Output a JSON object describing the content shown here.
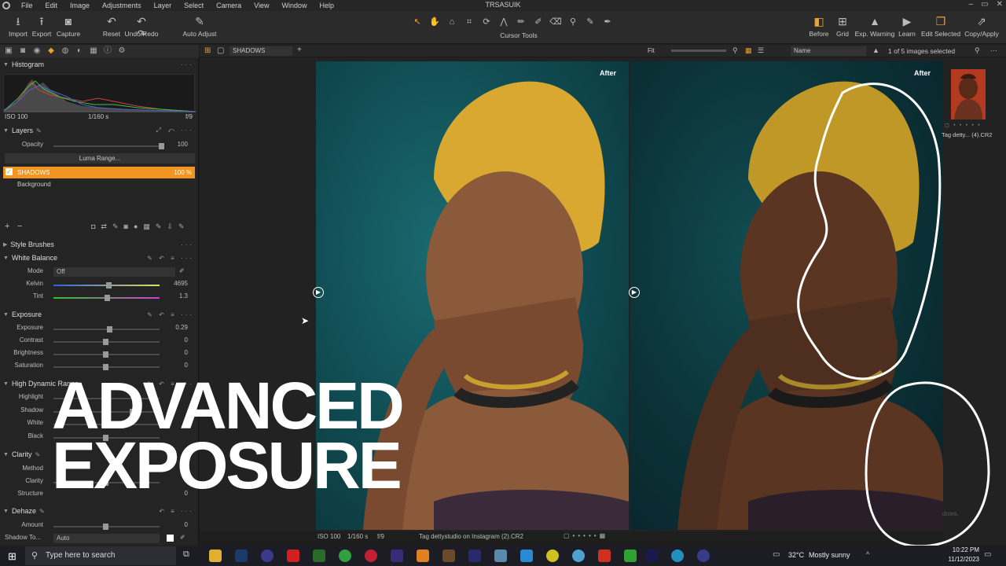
{
  "window": {
    "title": "TRSASUIK"
  },
  "menu": [
    "File",
    "Edit",
    "Image",
    "Adjustments",
    "Layer",
    "Select",
    "Camera",
    "View",
    "Window",
    "Help"
  ],
  "toolbar": {
    "left": [
      {
        "label": "Import",
        "icon": "import-icon"
      },
      {
        "label": "Export",
        "icon": "export-icon"
      },
      {
        "label": "Capture",
        "icon": "camera-icon"
      },
      {
        "label": "Reset",
        "icon": "reset-icon"
      },
      {
        "label": "Undo/Redo",
        "icon": "undo-redo-icon"
      },
      {
        "label": "Auto Adjust",
        "icon": "wand-icon"
      }
    ],
    "cursor_tools_label": "Cursor Tools",
    "right": [
      {
        "label": "Before",
        "icon": "before-icon"
      },
      {
        "label": "Grid",
        "icon": "grid-icon"
      },
      {
        "label": "Exp. Warning",
        "icon": "warning-icon"
      },
      {
        "label": "Learn",
        "icon": "play-icon"
      },
      {
        "label": "Edit Selected",
        "icon": "edit-selected-icon"
      },
      {
        "label": "Copy/Apply",
        "icon": "copy-apply-icon"
      }
    ]
  },
  "histogram": {
    "title": "Histogram",
    "iso": "ISO 100",
    "shutter": "1/160 s",
    "aperture": "f/9"
  },
  "layers": {
    "title": "Layers",
    "opacity_label": "Opacity",
    "opacity_value": "100",
    "luma_button": "Luma Range...",
    "active_layer": "SHADOWS",
    "active_layer_value": "100 %",
    "background_layer": "Background"
  },
  "style_brushes": {
    "title": "Style Brushes"
  },
  "white_balance": {
    "title": "White Balance",
    "mode_label": "Mode",
    "mode_value": "Off",
    "kelvin_label": "Kelvin",
    "kelvin_value": "4695",
    "tint_label": "Tint",
    "tint_value": "1.3"
  },
  "exposure": {
    "title": "Exposure",
    "rows": [
      {
        "label": "Exposure",
        "value": "0.29"
      },
      {
        "label": "Contrast",
        "value": "0"
      },
      {
        "label": "Brightness",
        "value": "0"
      },
      {
        "label": "Saturation",
        "value": "0"
      }
    ]
  },
  "hdr": {
    "title": "High Dynamic Range",
    "rows": [
      "Highlight",
      "Shadow",
      "White",
      "Black"
    ]
  },
  "clarity": {
    "title": "Clarity",
    "rows": [
      {
        "label": "Method",
        "value": ""
      },
      {
        "label": "Clarity",
        "value": ""
      },
      {
        "label": "Structure",
        "value": "0"
      }
    ]
  },
  "dehaze": {
    "title": "Dehaze",
    "amount_label": "Amount",
    "amount_value": "0",
    "shadow_tone_label": "Shadow To...",
    "shadow_tone_value": "Auto"
  },
  "viewer_bar": {
    "layer_select": "SHADOWS",
    "fit_label": "Fit",
    "sort_label": "Name",
    "images_count": "1 of 5 images selected"
  },
  "viewer": {
    "left_label": "After",
    "right_label": "After"
  },
  "statusbar": {
    "iso": "ISO 100",
    "shutter": "1/160 s",
    "aperture": "f/9",
    "filename": "Tag dettystudio on Instagram (2).CR2"
  },
  "browser": {
    "thumb_caption": "Tag detty... (4).CR2",
    "hint": "dows."
  },
  "overlay": {
    "line1": "ADVANCED",
    "line2": "EXPOSURE"
  },
  "taskbar": {
    "search_placeholder": "Type here to search",
    "weather_temp": "32°C",
    "weather_text": "Mostly sunny",
    "time": "10:22 PM",
    "date": "11/12/2023"
  },
  "colors": {
    "accent": "#f29422",
    "panel": "#242424",
    "viewer_bg": "#0f4a50"
  }
}
